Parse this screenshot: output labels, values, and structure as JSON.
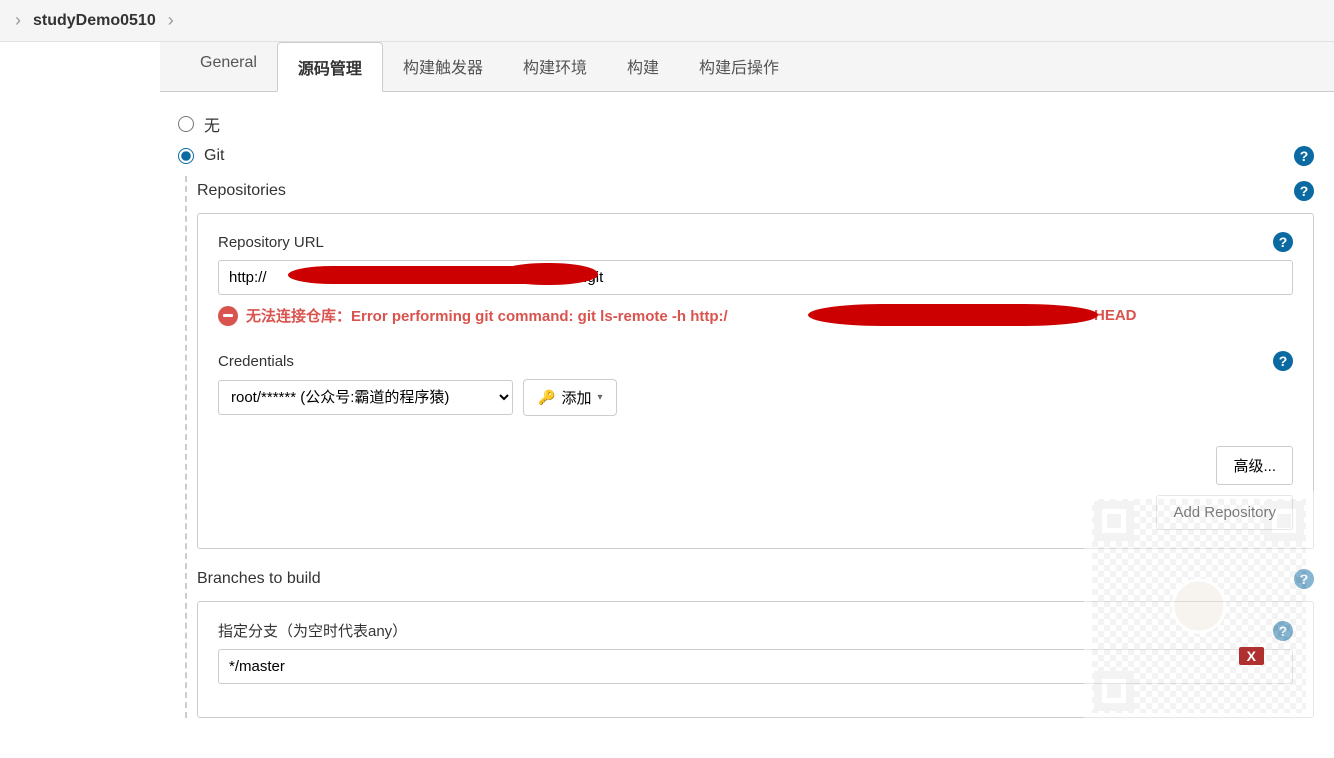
{
  "breadcrumb": {
    "project": "studyDemo0510"
  },
  "tabs": {
    "general": "General",
    "scm": "源码管理",
    "triggers": "构建触发器",
    "env": "构建环境",
    "build": "构建",
    "postbuild": "构建后操作"
  },
  "scm": {
    "none_label": "无",
    "git_label": "Git",
    "repositories_title": "Repositories",
    "repo_url_label": "Repository URL",
    "repo_url_value": "http://                                                                     emo.git",
    "error_prefix": "无法连接仓库：Error performing git command: git ls-remote -h http:/",
    "error_suffix": "tudydemo.git HEAD",
    "credentials_label": "Credentials",
    "credentials_value": "root/****** (公众号:霸道的程序猿)",
    "add_label": "添加",
    "advanced_label": "高级...",
    "add_repo_label": "Add Repository",
    "branches_title": "Branches to build",
    "branch_specifier_label": "指定分支（为空时代表any）",
    "branch_value": "*/master"
  },
  "icons": {
    "help": "?",
    "close_x": "X",
    "key": "🔑",
    "caret": "▾",
    "bc_sep": "›"
  }
}
